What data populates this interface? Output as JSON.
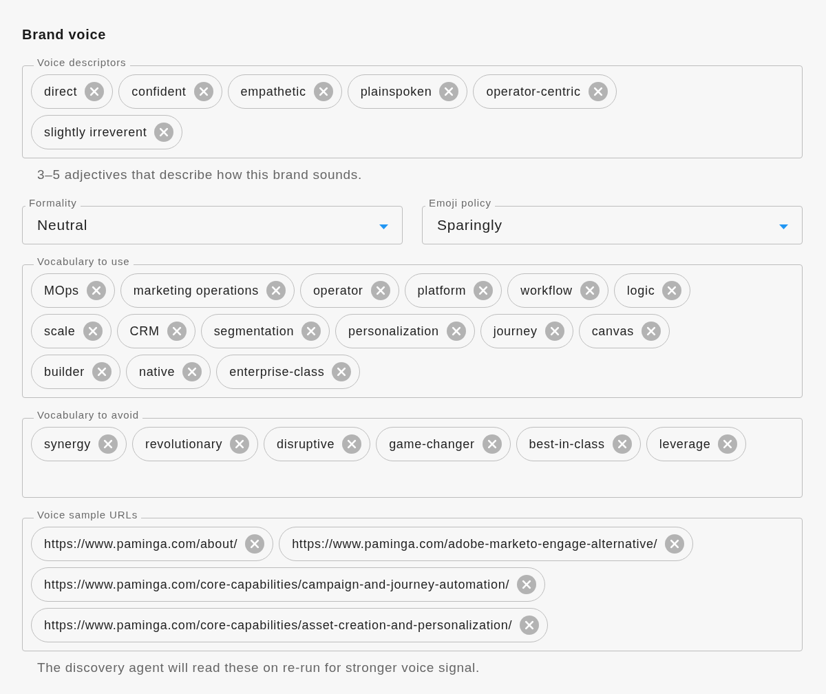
{
  "section": {
    "title": "Brand voice"
  },
  "fields": [
    {
      "kind": "tags",
      "label": "Voice descriptors",
      "tags": [
        "direct",
        "confident",
        "empathetic",
        "plainspoken",
        "operator-centric",
        "slightly irreverent"
      ],
      "helper": "3–5 adjectives that describe how this brand sounds."
    },
    {
      "kind": "selects",
      "selects": [
        {
          "label": "Formality",
          "value": "Neutral"
        },
        {
          "label": "Emoji policy",
          "value": "Sparingly"
        }
      ]
    },
    {
      "kind": "tags",
      "label": "Vocabulary to use",
      "tags": [
        "MOps",
        "marketing operations",
        "operator",
        "platform",
        "workflow",
        "logic",
        "scale",
        "CRM",
        "segmentation",
        "personalization",
        "journey",
        "canvas",
        "builder",
        "native",
        "enterprise-class"
      ]
    },
    {
      "kind": "tags",
      "label": "Vocabulary to avoid",
      "tags": [
        "synergy",
        "revolutionary",
        "disruptive",
        "game-changer",
        "best-in-class",
        "leverage"
      ]
    },
    {
      "kind": "tags",
      "label": "Voice sample URLs",
      "tags": [
        "https://www.paminga.com/about/",
        "https://www.paminga.com/adobe-marketo-engage-alternative/",
        "https://www.paminga.com/core-capabilities/campaign-and-journey-automation/",
        "https://www.paminga.com/core-capabilities/asset-creation-and-personalization/"
      ],
      "helper": "The discovery agent will read these on re-run for stronger voice signal."
    }
  ]
}
